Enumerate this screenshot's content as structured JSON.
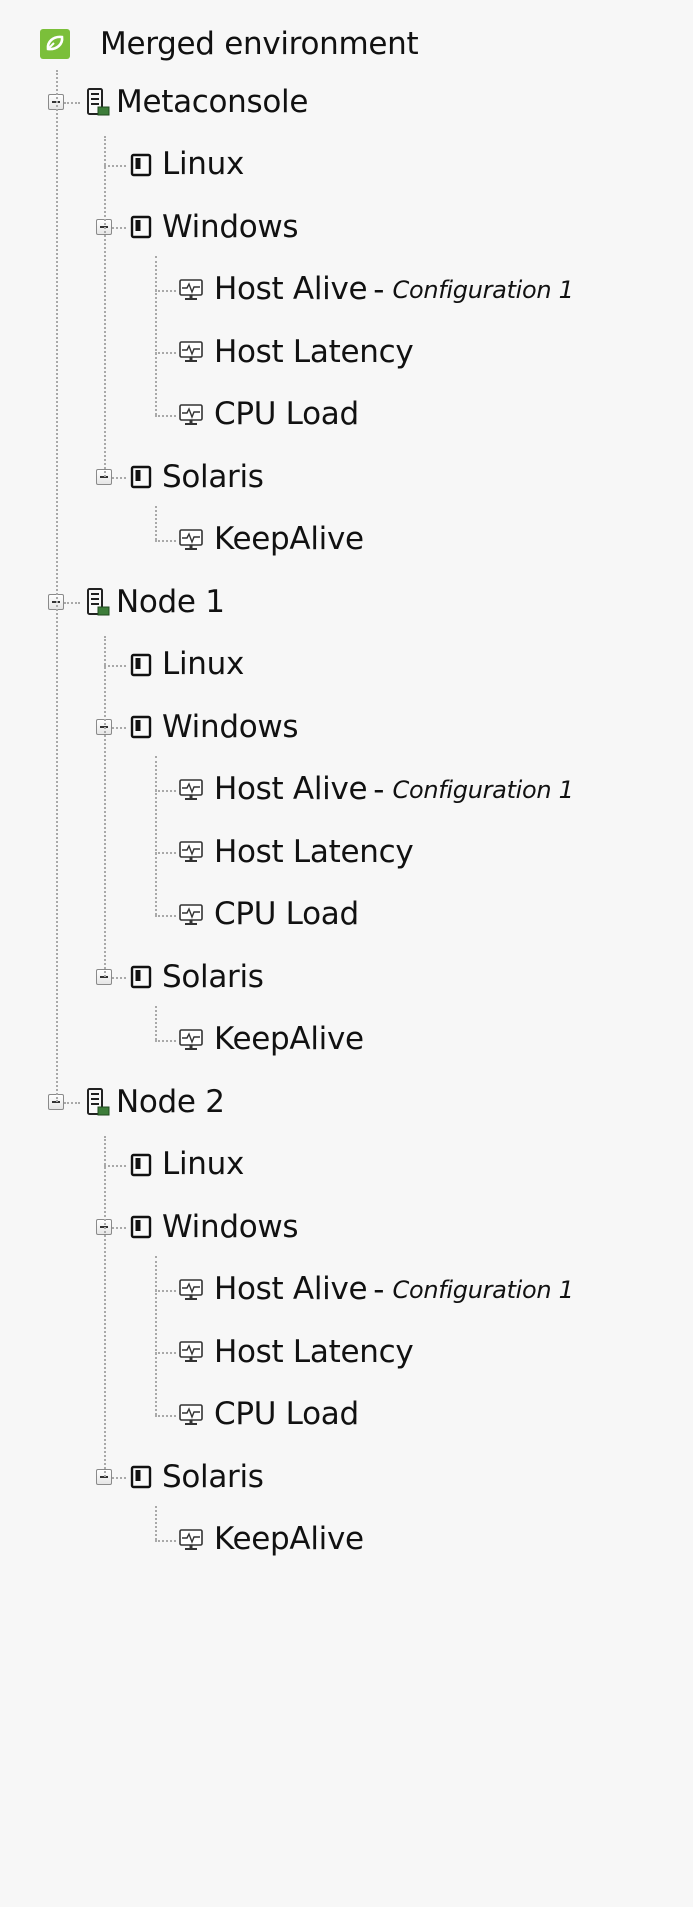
{
  "tree": {
    "root": {
      "label": "Merged environment",
      "icon": "pandora-logo-icon",
      "accent": "#7bbf3a"
    },
    "nodes": [
      {
        "label": "Metaconsole",
        "icon": "server-icon",
        "groups": [
          {
            "label": "Linux",
            "icon": "group-icon",
            "modules": []
          },
          {
            "label": "Windows",
            "icon": "group-icon",
            "modules": [
              {
                "label": "Host Alive",
                "separator": "-",
                "sub": "Configuration 1",
                "icon": "monitor-icon"
              },
              {
                "label": "Host Latency",
                "icon": "monitor-icon"
              },
              {
                "label": "CPU Load",
                "icon": "monitor-icon"
              }
            ]
          },
          {
            "label": "Solaris",
            "icon": "group-icon",
            "modules": [
              {
                "label": "KeepAlive",
                "icon": "monitor-icon"
              }
            ]
          }
        ]
      },
      {
        "label": "Node 1",
        "icon": "server-icon",
        "groups": [
          {
            "label": "Linux",
            "icon": "group-icon",
            "modules": []
          },
          {
            "label": "Windows",
            "icon": "group-icon",
            "modules": [
              {
                "label": "Host Alive",
                "separator": "-",
                "sub": "Configuration 1",
                "icon": "monitor-icon"
              },
              {
                "label": "Host Latency",
                "icon": "monitor-icon"
              },
              {
                "label": "CPU Load",
                "icon": "monitor-icon"
              }
            ]
          },
          {
            "label": "Solaris",
            "icon": "group-icon",
            "modules": [
              {
                "label": "KeepAlive",
                "icon": "monitor-icon"
              }
            ]
          }
        ]
      },
      {
        "label": "Node 2",
        "icon": "server-icon",
        "groups": [
          {
            "label": "Linux",
            "icon": "group-icon",
            "modules": []
          },
          {
            "label": "Windows",
            "icon": "group-icon",
            "modules": [
              {
                "label": "Host Alive",
                "separator": "-",
                "sub": "Configuration 1",
                "icon": "monitor-icon"
              },
              {
                "label": "Host Latency",
                "icon": "monitor-icon"
              },
              {
                "label": "CPU Load",
                "icon": "monitor-icon"
              }
            ]
          },
          {
            "label": "Solaris",
            "icon": "group-icon",
            "modules": [
              {
                "label": "KeepAlive",
                "icon": "monitor-icon"
              }
            ]
          }
        ]
      }
    ]
  }
}
